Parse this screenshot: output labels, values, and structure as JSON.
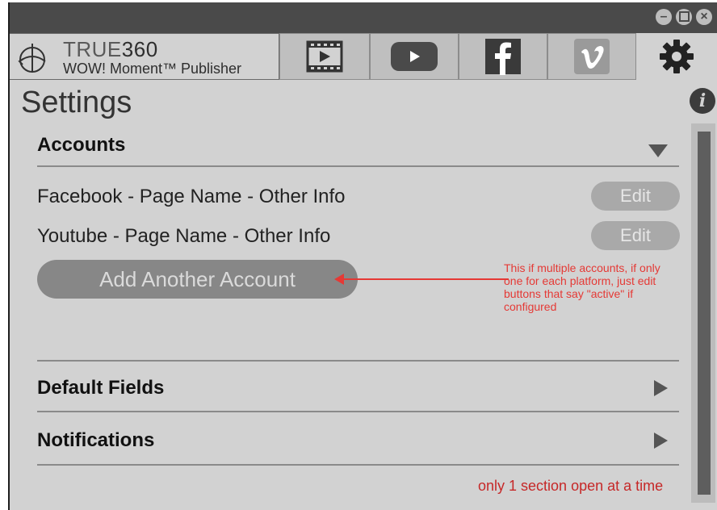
{
  "window": {
    "controls": [
      {
        "name": "minimize-icon"
      },
      {
        "name": "maximize-icon"
      },
      {
        "name": "close-icon"
      }
    ]
  },
  "brand": {
    "name_light": "TRUE",
    "name_bold": "360",
    "subtitle": "WOW! Moment™ Publisher",
    "logo_icon": "true360-logo-icon"
  },
  "nav": {
    "tabs": [
      {
        "icon": "video-icon"
      },
      {
        "icon": "youtube-icon"
      },
      {
        "icon": "facebook-icon"
      },
      {
        "icon": "vimeo-icon"
      },
      {
        "icon": "gear-icon",
        "active": true
      }
    ]
  },
  "page": {
    "title": "Settings",
    "info_icon_label": "i"
  },
  "sections": {
    "accounts": {
      "label": "Accounts",
      "rows": [
        {
          "text": "Facebook - Page Name - Other Info",
          "button": "Edit"
        },
        {
          "text": "Youtube - Page Name - Other Info",
          "button": "Edit"
        }
      ],
      "add_button": "Add Another Account"
    },
    "default_fields": {
      "label": "Default Fields"
    },
    "notifications": {
      "label": "Notifications"
    }
  },
  "annotations": {
    "add_account_note": "This if multiple accounts, if only one for each platform, just edit buttons that say \"active\" if configured",
    "footer_note": "only 1 section open at a time"
  },
  "colors": {
    "titlebar": "#4a4a4a",
    "background": "#d2d2d2",
    "annotation": "#e53935",
    "button_pill": "#878787"
  }
}
